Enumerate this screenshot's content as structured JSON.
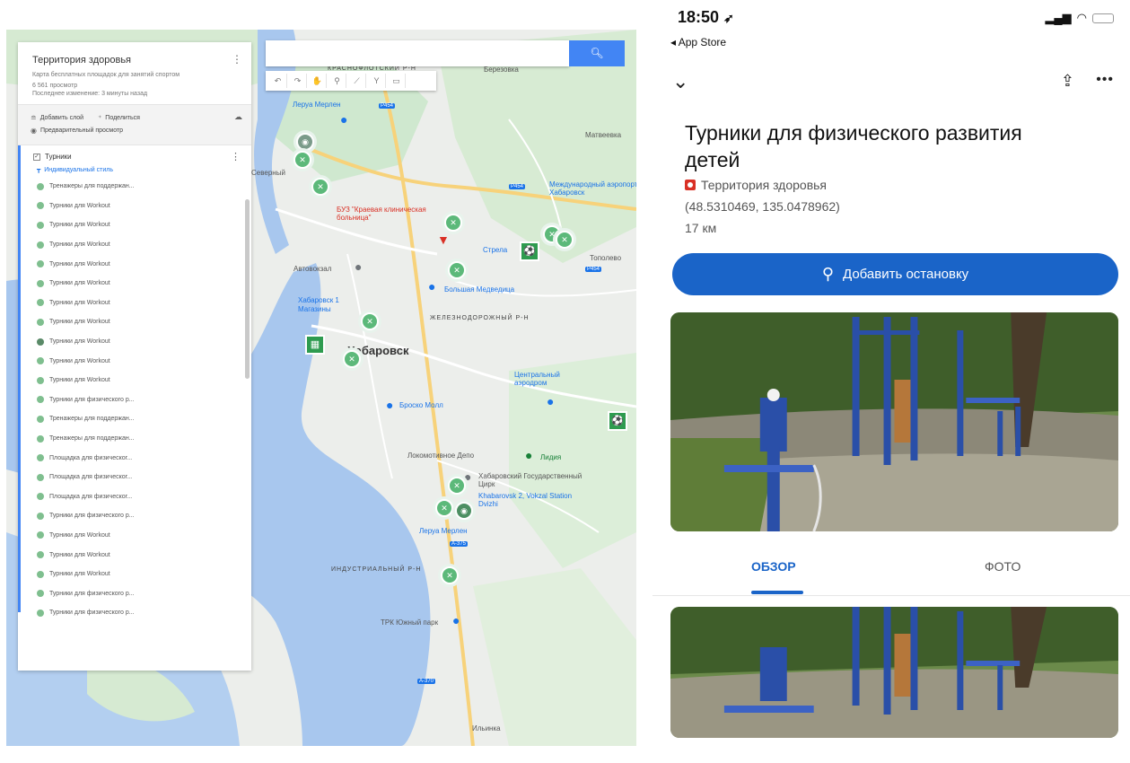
{
  "map_editor": {
    "title": "Территория здоровья",
    "description": "Карта бесплатных площадок для занятий спортом",
    "views": "6 561 просмотр",
    "last_modified": "Последнее изменение: 3 минуты назад",
    "add_layer": "Добавить слой",
    "share": "Поделиться",
    "preview": "Предварительный просмотр",
    "layer_name": "Турники",
    "layer_style": "Индивидуальный стиль",
    "layer_items": [
      "Тренажеры для поддержан...",
      "Турники для Workout",
      "Турники для Workout",
      "Турники для Workout",
      "Турники для Workout",
      "Турники для Workout",
      "Турники для Workout",
      "Турники для Workout",
      "Турники для Workout",
      "Турники для Workout",
      "Турники для Workout",
      "Турники для физического р...",
      "Тренажеры для поддержан...",
      "Тренажеры для поддержан...",
      "Площадка для физическог...",
      "Площадка для физическог...",
      "Площадка для физическог...",
      "Турники для физического р...",
      "Турники для Workout",
      "Турники для Workout",
      "Турники для Workout",
      "Турники для физического р...",
      "Турники для физического р..."
    ],
    "map_labels": {
      "krasnoflotsky": "КРАСНОФЛОТСКИЙ Р-Н",
      "berezovka": "Березовка",
      "leroy1": "Леруа Мерлен",
      "matveevka": "Матвеевка",
      "severny": "Северный",
      "p454a": "Р454",
      "p454b": "Р454",
      "p454c": "Р454",
      "airport_intl": "Международный аэропорт Хабаровск",
      "buz": "БУЗ \"Краевая клиническая больница\"",
      "strela": "Стрела",
      "topolevo": "Тополево",
      "avtovokzal": "Автовокзал",
      "bolshaya": "Большая Медведица",
      "khabarovsk_mall": "Хабаровск 1 Магазины",
      "zheleznodor": "ЖЕЛЕЗНОДОРОЖНЫЙ Р-Н",
      "city": "Хабаровск",
      "central_airport": "Центральный аэродром",
      "brosko": "Броско Молл",
      "lokomotiv": "Локомотивное Депо",
      "lidiya": "Лидия",
      "circus": "Хабаровский Государственный Цирк",
      "vokzal2": "Khabarovsk 2, Vokzal Station Dvizhi",
      "leroy2": "Леруа Мерлен",
      "a375a": "А-375",
      "industrial": "ИНДУСТРИАЛЬНЫЙ Р-Н",
      "trk": "ТРК Южный парк",
      "a370": "А-370",
      "ilyinka": "Ильинка"
    }
  },
  "phone": {
    "status_time": "18:50",
    "back_app": "◂ App Store",
    "place_title": "Турники для физического развития детей",
    "list_name": "Территория здоровья",
    "coordinates": "(48.5310469, 135.0478962)",
    "distance": "17 км",
    "add_stop_label": "Добавить остановку",
    "tabs": {
      "overview": "ОБЗОР",
      "photos": "ФОТО"
    }
  }
}
